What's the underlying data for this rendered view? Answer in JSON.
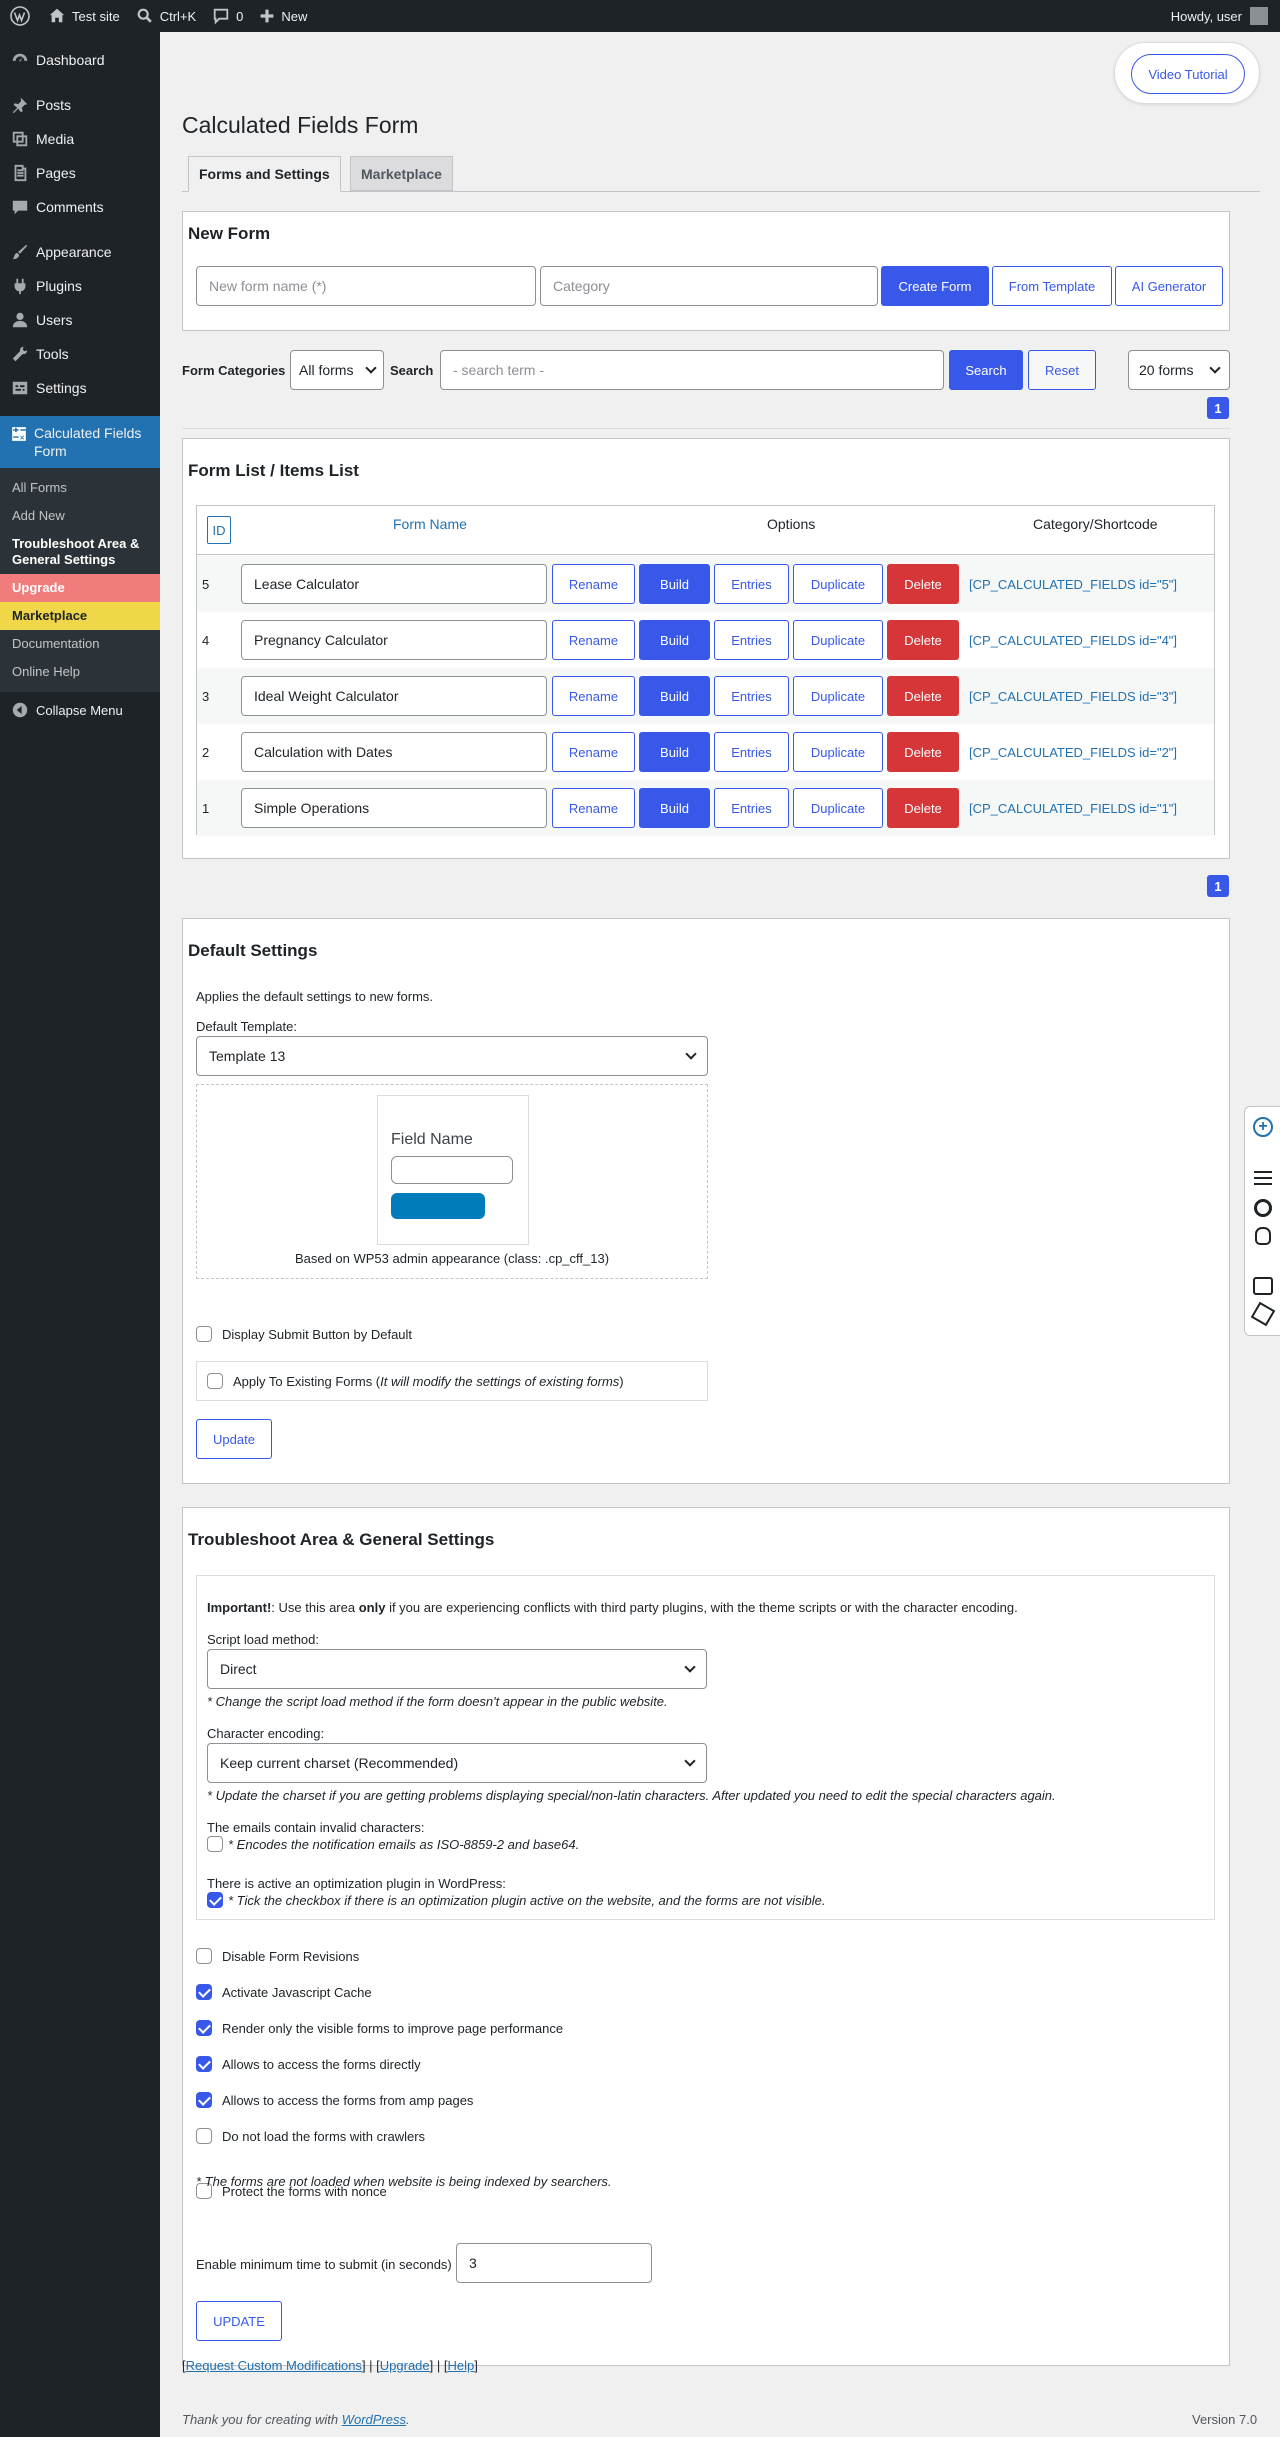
{
  "adminbar": {
    "site_name": "Test site",
    "search_shortcut": "Ctrl+K",
    "comments_count": "0",
    "new_label": "New",
    "howdy": "Howdy, user"
  },
  "sidebar": {
    "items": [
      {
        "label": "Dashboard",
        "icon": "dashboard-icon"
      },
      {
        "label": "Posts",
        "icon": "pin-icon"
      },
      {
        "label": "Media",
        "icon": "media-icon"
      },
      {
        "label": "Pages",
        "icon": "pages-icon"
      },
      {
        "label": "Comments",
        "icon": "comment-icon"
      },
      {
        "label": "Appearance",
        "icon": "brush-icon"
      },
      {
        "label": "Plugins",
        "icon": "plugin-icon"
      },
      {
        "label": "Users",
        "icon": "user-icon"
      },
      {
        "label": "Tools",
        "icon": "wrench-icon"
      },
      {
        "label": "Settings",
        "icon": "settings-icon"
      }
    ],
    "current": "Calculated Fields Form",
    "submenu": [
      "All Forms",
      "Add New",
      "Troubleshoot Area & General Settings",
      "Upgrade",
      "Marketplace",
      "Documentation",
      "Online Help"
    ],
    "collapse": "Collapse Menu"
  },
  "header": {
    "video_tutorial": "Video Tutorial",
    "title": "Calculated Fields Form",
    "tabs": [
      "Forms and Settings",
      "Marketplace"
    ]
  },
  "new_form": {
    "title": "New Form",
    "name_placeholder": "New form name (*)",
    "category_placeholder": "Category",
    "create": "Create Form",
    "from_template": "From Template",
    "ai_generator": "AI Generator"
  },
  "filter": {
    "categories_label": "Form Categories",
    "categories_value": "All forms",
    "search_label": "Search",
    "search_placeholder": "- search term -",
    "search_button": "Search",
    "reset_button": "Reset",
    "per_page": "20 forms",
    "page": "1"
  },
  "form_list": {
    "title": "Form List / Items List",
    "headers": {
      "id": "ID",
      "name": "Form Name",
      "options": "Options",
      "shortcode": "Category/Shortcode"
    },
    "actions": {
      "rename": "Rename",
      "build": "Build",
      "entries": "Entries",
      "duplicate": "Duplicate",
      "delete": "Delete"
    },
    "rows": [
      {
        "id": "5",
        "name": "Lease Calculator",
        "shortcode": "[CP_CALCULATED_FIELDS id=\"5\"]"
      },
      {
        "id": "4",
        "name": "Pregnancy Calculator",
        "shortcode": "[CP_CALCULATED_FIELDS id=\"4\"]"
      },
      {
        "id": "3",
        "name": "Ideal Weight Calculator",
        "shortcode": "[CP_CALCULATED_FIELDS id=\"3\"]"
      },
      {
        "id": "2",
        "name": "Calculation with Dates",
        "shortcode": "[CP_CALCULATED_FIELDS id=\"2\"]"
      },
      {
        "id": "1",
        "name": "Simple Operations",
        "shortcode": "[CP_CALCULATED_FIELDS id=\"1\"]"
      }
    ],
    "page": "1"
  },
  "default_settings": {
    "title": "Default Settings",
    "desc": "Applies the default settings to new forms.",
    "template_label": "Default Template:",
    "template_value": "Template 13",
    "preview_field": "Field Name",
    "preview_caption": "Based on WP53 admin appearance (class: .cp_cff_13)",
    "display_submit": "Display Submit Button by Default",
    "apply_existing": "Apply To Existing Forms (",
    "apply_existing_note": "It will modify the settings of existing forms",
    "apply_existing_end": ")",
    "update": "Update"
  },
  "troubleshoot": {
    "title": "Troubleshoot Area & General Settings",
    "important_label": "Important!",
    "important_a": ": Use this area ",
    "important_only": "only",
    "important_b": " if you are experiencing conflicts with third party plugins, with the theme scripts or with the character encoding.",
    "script_label": "Script load method:",
    "script_value": "Direct",
    "script_note": "* Change the script load method if the form doesn't appear in the public website.",
    "charset_label": "Character encoding:",
    "charset_value": "Keep current charset (Recommended)",
    "charset_note": "* Update the charset if you are getting problems displaying special/non-latin characters. After updated you need to edit the special characters again.",
    "emails_label": "The emails contain invalid characters:",
    "emails_note": "* Encodes the notification emails as ISO-8859-2 and base64.",
    "optim_label": "There is active an optimization plugin in WordPress:",
    "optim_note": "* Tick the checkbox if there is an optimization plugin active on the website, and the forms are not visible.",
    "options": [
      {
        "label": "Disable Form Revisions",
        "checked": false
      },
      {
        "label": "Activate Javascript Cache",
        "checked": true
      },
      {
        "label": "Render only the visible forms to improve page performance",
        "checked": true
      },
      {
        "label": "Allows to access the forms directly",
        "checked": true
      },
      {
        "label": "Allows to access the forms from amp pages",
        "checked": true
      },
      {
        "label": "Do not load the forms with crawlers",
        "checked": false
      },
      {
        "label": "Protect the forms with nonce",
        "checked": false
      }
    ],
    "crawler_note": "* The forms are not loaded when website is being indexed by searchers.",
    "min_time_label": "Enable minimum time to submit (in seconds)",
    "min_time_value": "3",
    "update": "UPDATE"
  },
  "footer_links": {
    "request": "Request Custom Modifications",
    "upgrade": "Upgrade",
    "help": "Help"
  },
  "footer": {
    "thanks": "Thank you for creating with ",
    "wordpress": "WordPress",
    "version": "Version 7.0"
  }
}
